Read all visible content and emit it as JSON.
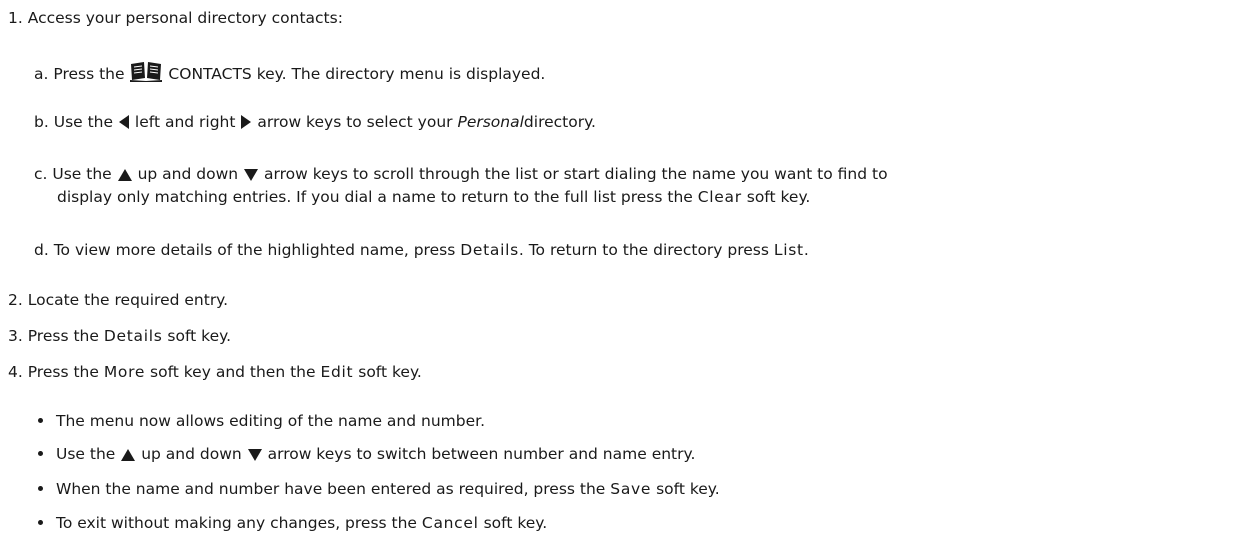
{
  "steps": [
    {
      "number": "1.",
      "text": "Access your personal directory contacts:",
      "substeps": [
        {
          "letter": "a.",
          "pre": "Press the",
          "icon": "book-icon",
          "post": "CONTACTS key. The directory menu is displayed."
        },
        {
          "letter": "b.",
          "pre": "Use the",
          "icon_left": "left-arrow-icon",
          "mid": "left and right",
          "icon_right": "right-arrow-icon",
          "post_a": "arrow keys to select your",
          "italic": "Personal",
          "post_b": "directory."
        },
        {
          "letter": "c.",
          "pre": "Use the",
          "icon_up": "up-arrow-icon",
          "mid": "up and down",
          "icon_down": "down-arrow-icon",
          "post": "arrow keys to scroll through the list or start dialing the name you want to find to",
          "line2_pre": "display only matching entries. If you dial a name to return to the full list press the",
          "line2_key": "Clear",
          "line2_post": "soft key."
        },
        {
          "letter": "d.",
          "pre": "To view more details of the highlighted name, press",
          "key1": "Details",
          "mid": ". To return to the directory press",
          "key2": "List",
          "post": "."
        }
      ]
    },
    {
      "number": "2.",
      "text": "Locate the required entry."
    },
    {
      "number": "3.",
      "pre": "Press the",
      "key": "Details",
      "post": "soft key."
    },
    {
      "number": "4.",
      "pre": "Press the",
      "key1": "More",
      "mid": "soft key and then the",
      "key2": "Edit",
      "post": "soft key.",
      "bullets": [
        {
          "text": "The menu now allows editing of the name and number."
        },
        {
          "pre": "Use the",
          "icon_up": "up-arrow-icon",
          "mid": "up and down",
          "icon_down": "down-arrow-icon",
          "post": "arrow keys to switch between number and name entry."
        },
        {
          "pre": "When the name and number have been entered as required, press the",
          "key": "Save",
          "post": "soft key."
        },
        {
          "pre": "To exit without making any changes, press the",
          "key": "Cancel",
          "post": "soft key."
        }
      ]
    }
  ]
}
